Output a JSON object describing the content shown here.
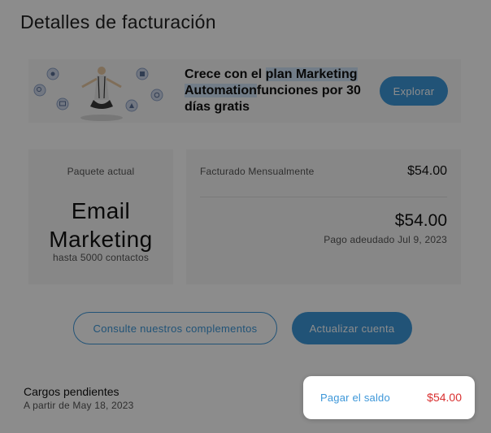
{
  "page": {
    "title": "Detalles de facturación"
  },
  "promo": {
    "text_a": "Crece con el ",
    "text_highlight_1": "plan Marketing",
    "text_highlight_2": "Automation",
    "text_b": "funciones por 30 días gratis",
    "explore_label": "Explorar",
    "icons": [
      "settings-icon",
      "search-icon",
      "mail-icon",
      "calendar-icon",
      "refresh-icon",
      "chart-icon"
    ]
  },
  "package": {
    "label": "Paquete actual",
    "name": "Email Marketing",
    "subtitle": "hasta 5000 contactos"
  },
  "billing": {
    "frequency_label": "Facturado Mensualmente",
    "frequency_amount": "$54.00",
    "total_amount": "$54.00",
    "due_label": "Pago adeudado Jul 9, 2023"
  },
  "actions": {
    "addons_label": "Consulte nuestros complementos",
    "update_label": "Actualizar cuenta"
  },
  "pending": {
    "title": "Cargos pendientes",
    "date": "A partir de May 18, 2023",
    "pay_label": "Pagar el saldo",
    "pay_amount": "$54.00"
  },
  "colors": {
    "accent": "#3d97d9",
    "danger": "#d93030",
    "overlay": "rgba(0,0,0,0.45)"
  }
}
